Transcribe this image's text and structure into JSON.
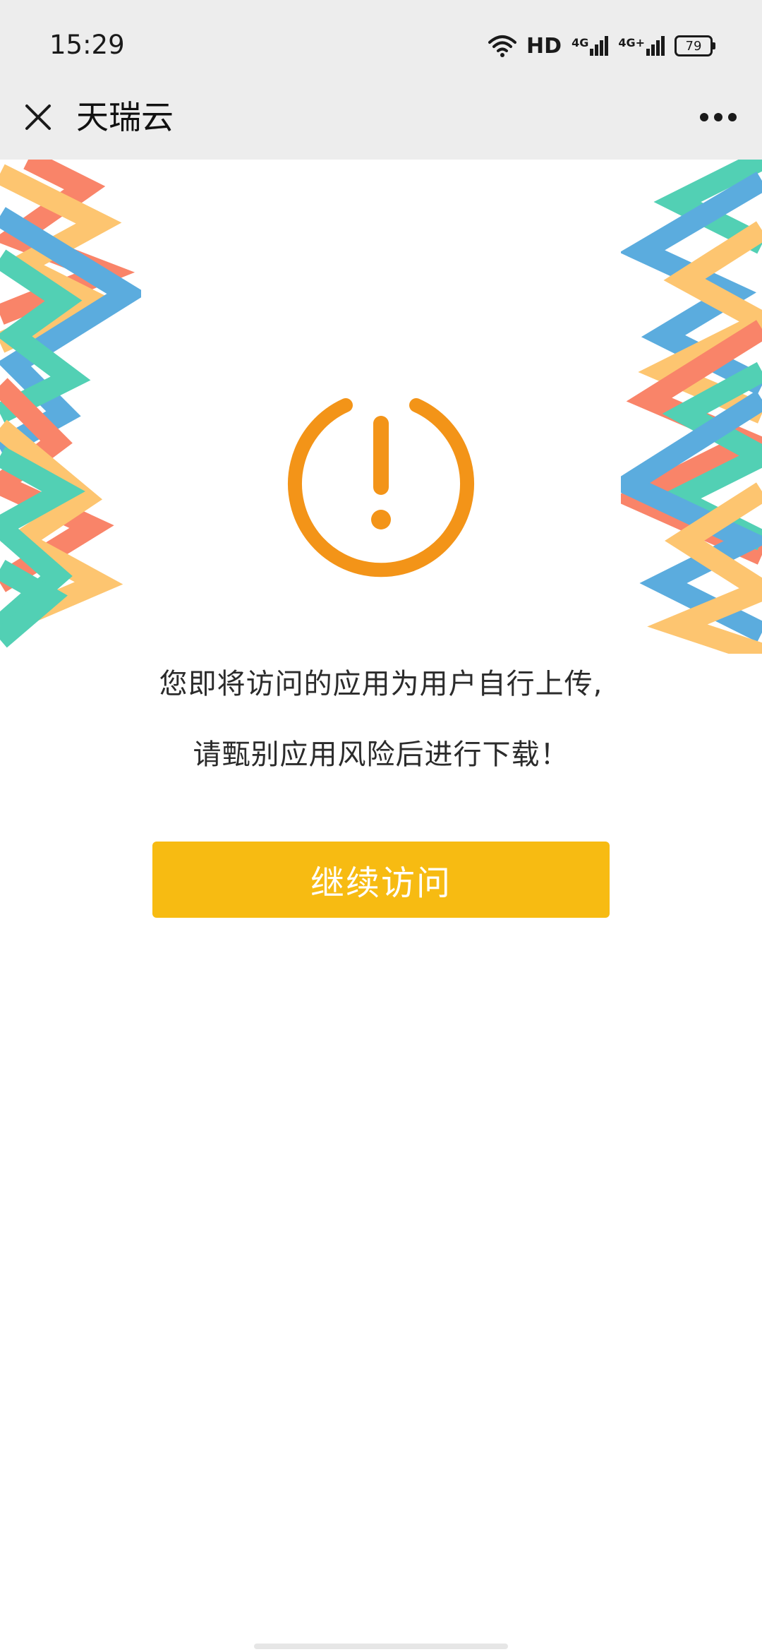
{
  "status_bar": {
    "time": "15:29",
    "network_label": "HD",
    "signal_1_label": "4G",
    "signal_2_label": "4G+",
    "battery_level": "79"
  },
  "nav": {
    "title": "天瑞云"
  },
  "icons": {
    "close": "close-icon",
    "more": "more-icon",
    "warning": "warning-icon",
    "wifi": "wifi-icon"
  },
  "main": {
    "message_line_1": "您即将访问的应用为用户自行上传,",
    "message_line_2": "请甄别应用风险后进行下载！",
    "continue_button": "继续访问"
  },
  "colors": {
    "accent": "#f7bb12",
    "warning_orange": "#f39418",
    "ribbon_red": "#f8623f",
    "ribbon_yellow": "#fdb648",
    "ribbon_blue": "#2e95d6",
    "ribbon_teal": "#22c3a0"
  }
}
